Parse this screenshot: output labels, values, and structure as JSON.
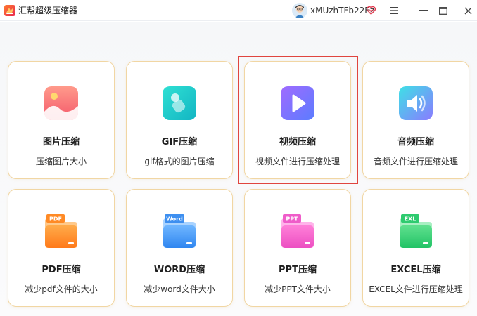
{
  "app": {
    "title": "汇帮超级压缩器",
    "username": "xMUzhTFb22Ez"
  },
  "colors": {
    "card_border": "#f1d6a3",
    "highlight": "#e0453f",
    "brand": "#f04a5a"
  },
  "window_controls": [
    "menu-icon",
    "minimize-icon",
    "maximize-icon",
    "close-icon"
  ],
  "tools": [
    {
      "name": "图片压缩",
      "desc": "压缩图片大小",
      "icon": "image-icon"
    },
    {
      "name": "GIF压缩",
      "desc": "gif格式的图片压缩",
      "icon": "gif-icon"
    },
    {
      "name": "视频压缩",
      "desc": "视频文件进行压缩处理",
      "icon": "video-icon",
      "selected": true
    },
    {
      "name": "音频压缩",
      "desc": "音频文件进行压缩处理",
      "icon": "audio-icon"
    },
    {
      "name": "PDF压缩",
      "desc": "减少pdf文件的大小",
      "icon": "pdf-icon",
      "tag": "PDF"
    },
    {
      "name": "WORD压缩",
      "desc": "减少word文件大小",
      "icon": "word-icon",
      "tag": "Word"
    },
    {
      "name": "PPT压缩",
      "desc": "减少PPT文件大小",
      "icon": "ppt-icon",
      "tag": "PPT"
    },
    {
      "name": "EXCEL压缩",
      "desc": "EXCEL文件进行压缩处理",
      "icon": "excel-icon",
      "tag": "EXL"
    }
  ]
}
